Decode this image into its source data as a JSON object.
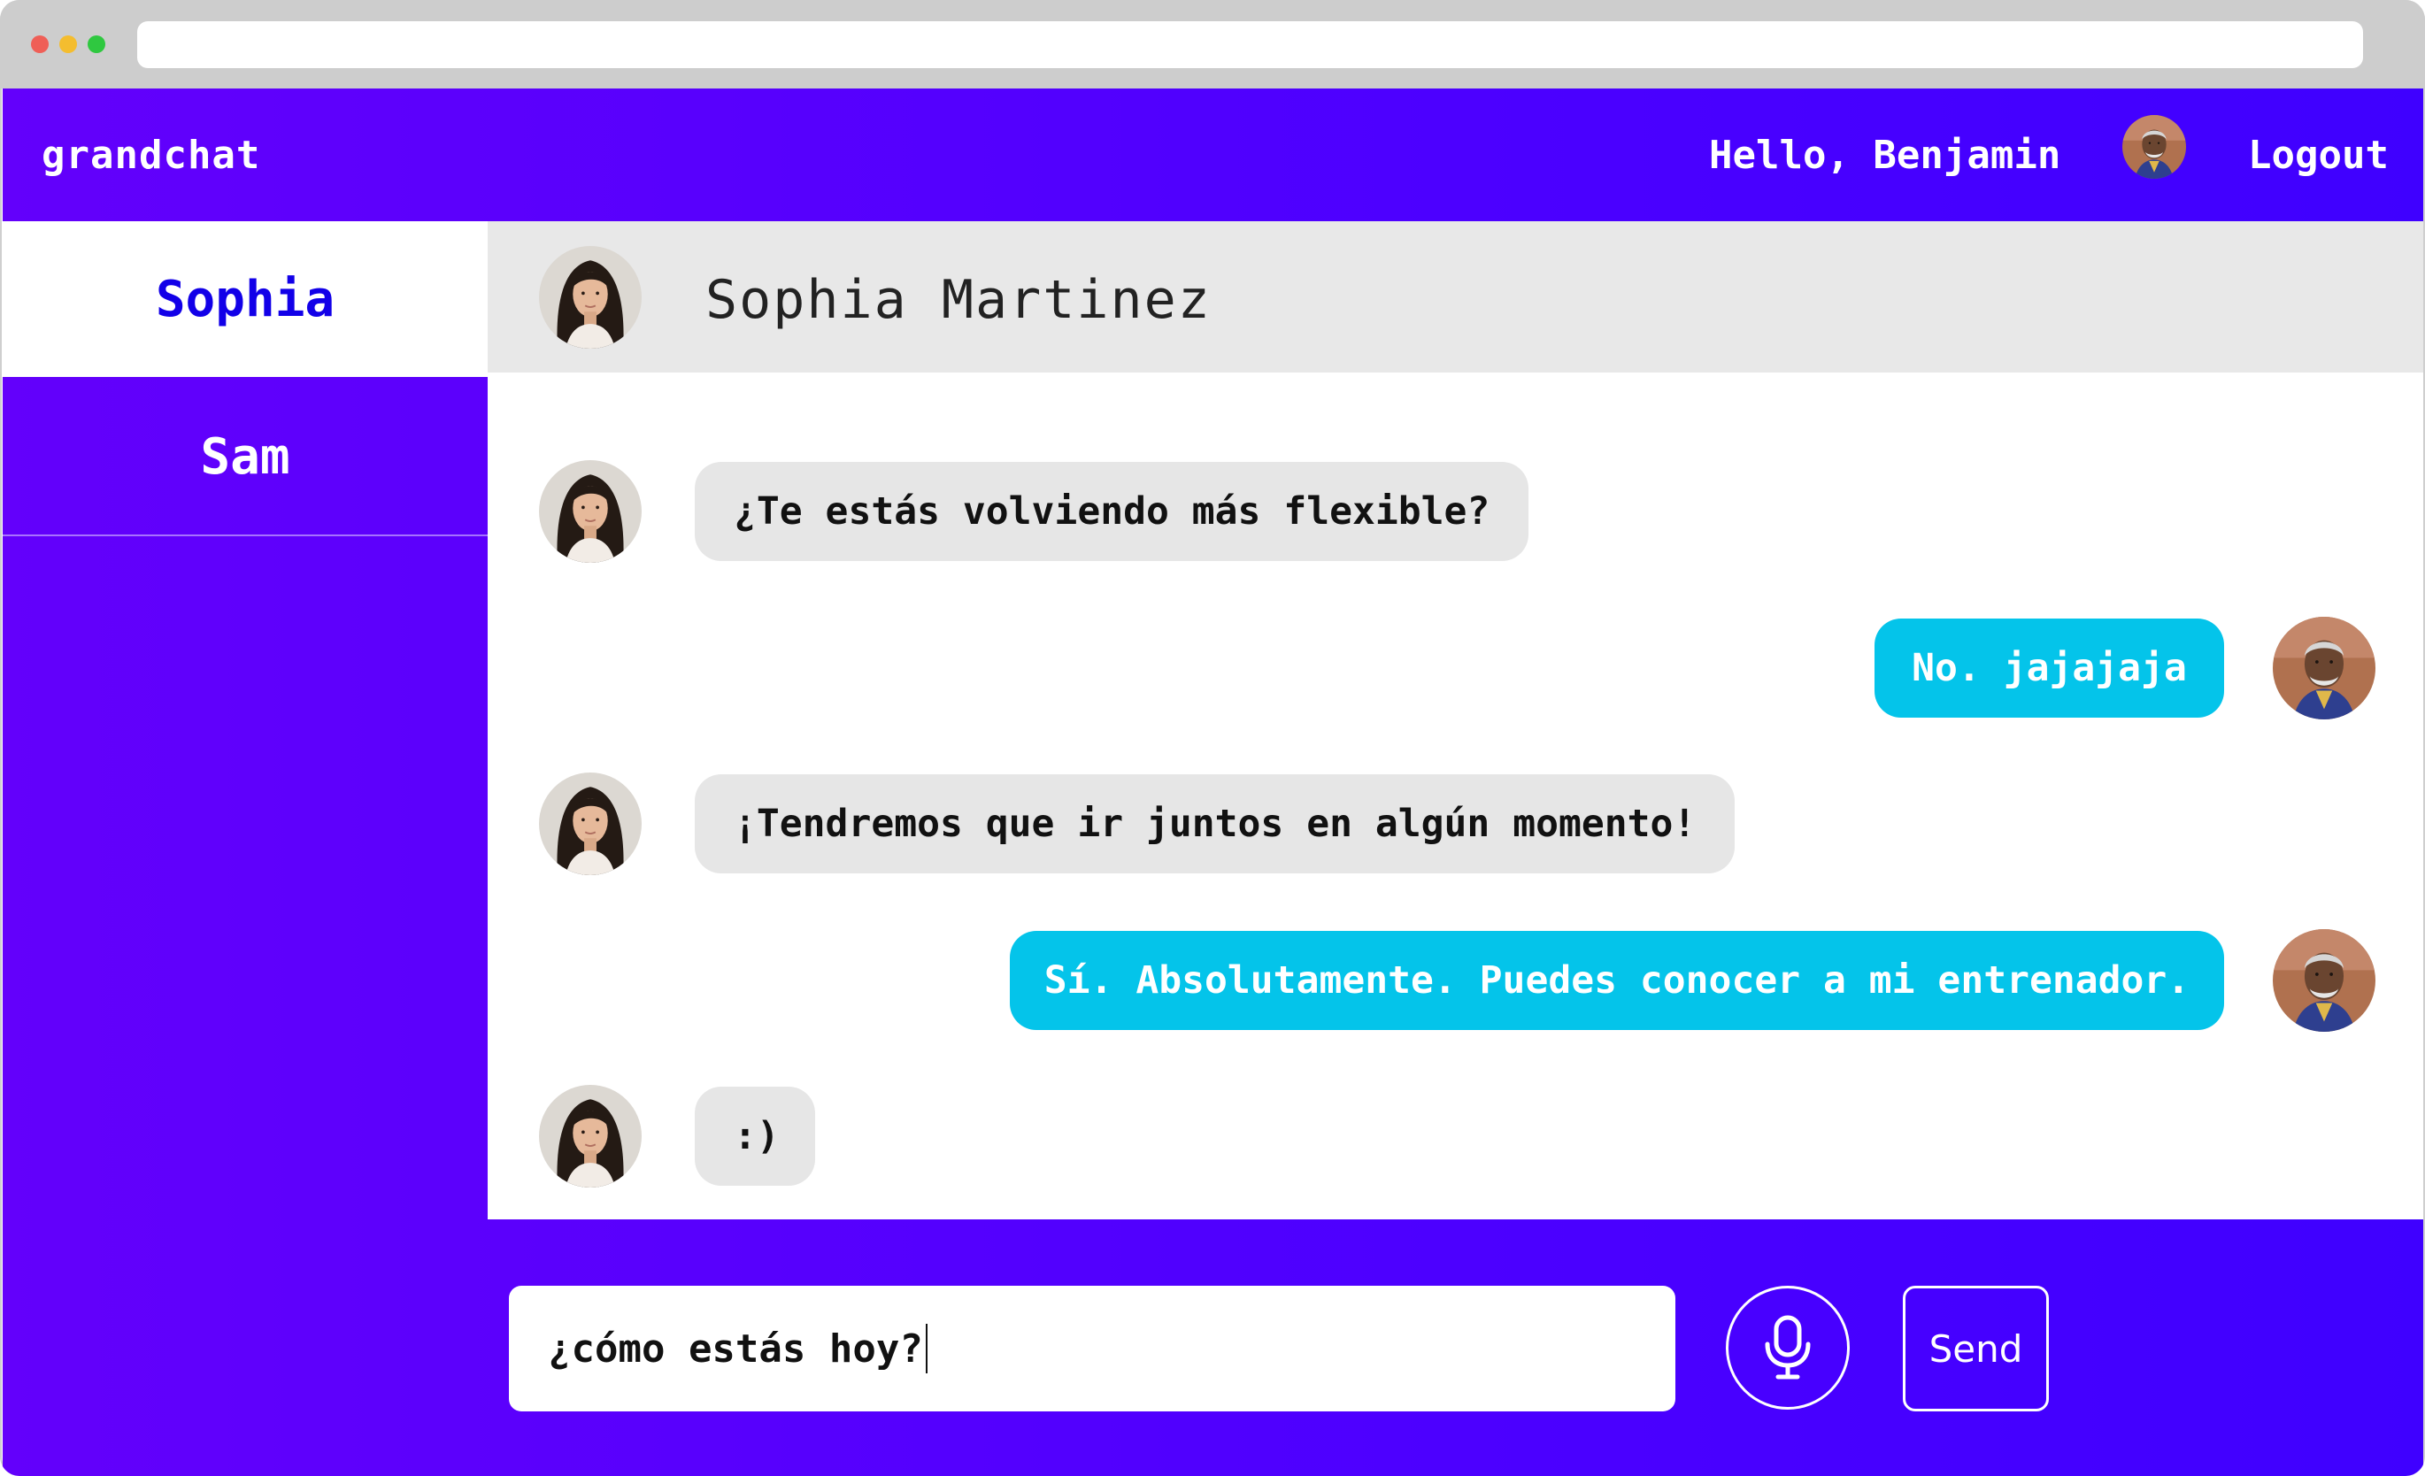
{
  "app": {
    "brand": "grandchat"
  },
  "header": {
    "greeting": "Hello, Benjamin",
    "logout_label": "Logout"
  },
  "sidebar": {
    "items": [
      {
        "label": "Sophia",
        "active": true
      },
      {
        "label": "Sam",
        "active": false
      }
    ]
  },
  "chat": {
    "contact_name": "Sophia Martinez",
    "messages": [
      {
        "from": "contact",
        "text": ""
      },
      {
        "from": "contact",
        "text": "¿Te estás volviendo más flexible?"
      },
      {
        "from": "me",
        "text": "No. jajajaja"
      },
      {
        "from": "contact",
        "text": "¡Tendremos que ir juntos en algún momento!"
      },
      {
        "from": "me",
        "text": "Sí. Absolutamente. Puedes conocer a mi entrenador."
      },
      {
        "from": "contact",
        "text": ":)"
      }
    ]
  },
  "composer": {
    "input_value": "¿cómo estás hoy?",
    "send_label": "Send"
  },
  "colors": {
    "brand_purple": "#4c00ff",
    "active_contact": "#1200e8",
    "outgoing_bubble": "#04c4ea",
    "incoming_bubble": "#e6e6e6",
    "header_gray": "#e8e8e8"
  },
  "icons": {
    "mic": "microphone-icon"
  }
}
